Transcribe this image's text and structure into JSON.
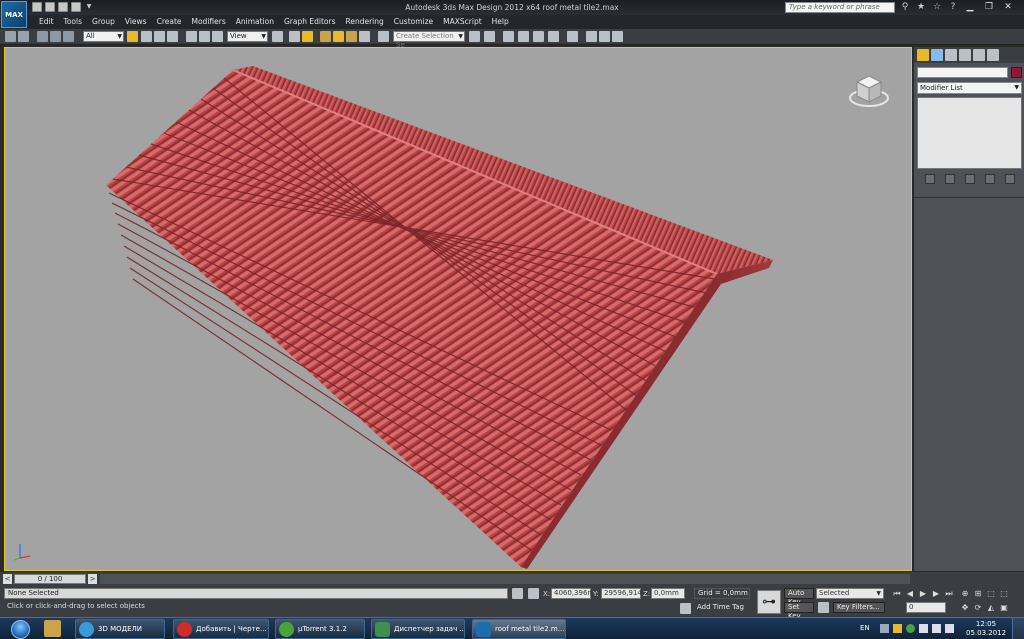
{
  "titlebar": {
    "app_logo_text": "MAX",
    "title": "Autodesk 3ds Max Design 2012 x64      roof metal tile2.max",
    "search_placeholder": "Type a keyword or phrase"
  },
  "menu": {
    "items": [
      "Edit",
      "Tools",
      "Group",
      "Views",
      "Create",
      "Modifiers",
      "Animation",
      "Graph Editors",
      "Rendering",
      "Customize",
      "MAXScript",
      "Help"
    ]
  },
  "toolbar": {
    "selection_filter": "All",
    "reference_coord": "View",
    "selection_set_placeholder": "Create Selection Se"
  },
  "command_panel": {
    "modifier_list": "Modifier List",
    "object_color": "#8b1a3a"
  },
  "timeslider": {
    "frame_display": "0 / 100",
    "left_arrow": "<",
    "right_arrow": ">"
  },
  "status": {
    "selection": "None Selected",
    "prompt": "Click or click-and-drag to select objects",
    "x_label": "X:",
    "x_value": "4060,396n",
    "y_label": "Y:",
    "y_value": "29596,914",
    "z_label": "Z:",
    "z_value": "0,0mm",
    "grid": "Grid = 0,0mm",
    "add_time_tag": "Add Time Tag",
    "auto_key": "Auto Key",
    "set_key": "Set Key",
    "key_mode": "Selected",
    "key_filters": "Key Filters...",
    "current_frame": "0"
  },
  "taskbar": {
    "items": [
      {
        "label": "3D МОДЕЛИ",
        "color": "#3a9ad9"
      },
      {
        "label": "Добавить | Черте...",
        "color": "#d12a2a"
      },
      {
        "label": "µTorrent 3.1.2",
        "color": "#4aa33a"
      },
      {
        "label": "Диспетчер задач ...",
        "color": "#3f8f4f"
      },
      {
        "label": "roof metal tile2.m...",
        "color": "#1b6ea8"
      }
    ],
    "language": "EN",
    "time": "12:05",
    "date": "05.03.2012"
  }
}
